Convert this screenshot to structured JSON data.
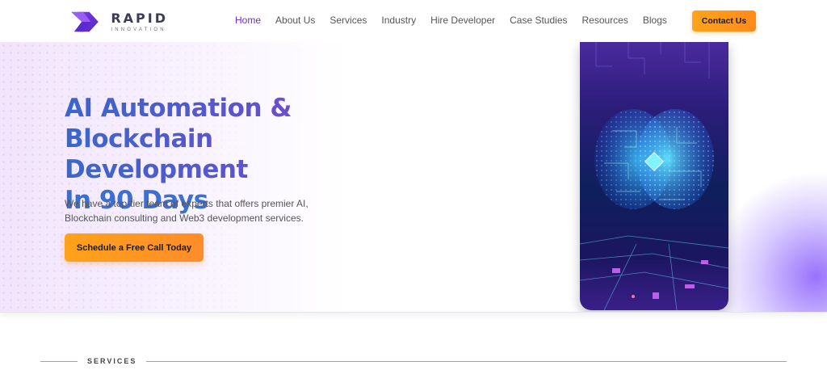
{
  "header": {
    "logo": {
      "word": "RAPID",
      "sub": "INNOVATION"
    },
    "nav": [
      {
        "label": "Home",
        "active": true
      },
      {
        "label": "About Us"
      },
      {
        "label": "Services"
      },
      {
        "label": "Industry"
      },
      {
        "label": "Hire Developer"
      },
      {
        "label": "Case Studies"
      },
      {
        "label": "Resources"
      },
      {
        "label": "Blogs"
      }
    ],
    "contact_label": "Contact Us"
  },
  "hero": {
    "title_lines": [
      "AI Automation &",
      "Blockchain Development",
      "In 90 Days"
    ],
    "description": "We have a top-tier team of experts that offers premier AI, Blockchain consulting and Web3 development services.",
    "cta_label": "Schedule a Free Call Today",
    "image_icon": "ai-brain-circuit-illustration"
  },
  "services": {
    "label": "SERVICES"
  },
  "colors": {
    "accent": "#6a2fd0",
    "cta": "#ff9a1a",
    "title_blue": "#3a67c9",
    "title_purple": "#8a3fd1"
  }
}
